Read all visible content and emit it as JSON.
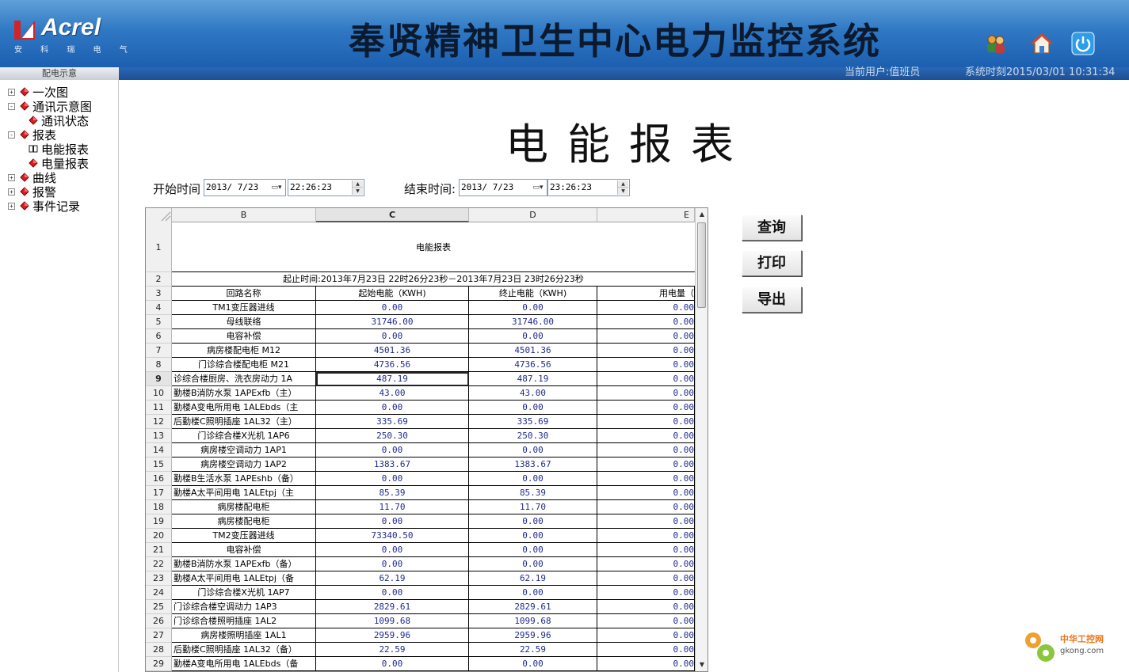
{
  "header": {
    "logo_text": "Acrel",
    "logo_sub": "安 科 瑞 电 气",
    "system_title": "奉贤精神卫生中心电力监控系统",
    "current_user": "当前用户:值班员",
    "system_time": "系统时刻2015/03/01 10:31:34",
    "icons": [
      "users-icon",
      "home-icon",
      "power-icon"
    ]
  },
  "sidebar": {
    "title": "配电示意",
    "items": [
      {
        "label": "一次图",
        "expander": "+"
      },
      {
        "label": "通讯示意图",
        "expander": "-"
      },
      {
        "label": "通讯状态",
        "expander": ""
      },
      {
        "label": "报表",
        "expander": "-"
      },
      {
        "label": "电能报表",
        "expander": ""
      },
      {
        "label": "电量报表",
        "expander": ""
      },
      {
        "label": "曲线",
        "expander": "+"
      },
      {
        "label": "报警",
        "expander": "+"
      },
      {
        "label": "事件记录",
        "expander": "+"
      }
    ]
  },
  "report": {
    "title": "电能报表",
    "start_label": "开始时间",
    "start_date": "2013/ 7/23",
    "start_time": "22:26:23",
    "end_label": "结束时间:",
    "end_date": "2013/ 7/23",
    "end_time": "23:26:23",
    "buttons": {
      "query": "查询",
      "print": "打印",
      "export": "导出"
    }
  },
  "grid": {
    "columns": [
      "B",
      "C",
      "D",
      "E"
    ],
    "selected_column": "C",
    "title_row": "电能报表",
    "period_row": "起止时间:2013年7月23日 22时26分23秒－2013年7月23日 23时26分23秒",
    "header_row": {
      "b": "回路名称",
      "c": "起始电能（KWH)",
      "d": "终止电能（KWH)",
      "e": "用电量（"
    },
    "selected_row": "9",
    "rows": [
      {
        "n": "4",
        "b": "TM1变压器进线",
        "c": "0.00",
        "d": "0.00",
        "e": "0.00"
      },
      {
        "n": "5",
        "b": "母线联络",
        "c": "31746.00",
        "d": "31746.00",
        "e": "0.00"
      },
      {
        "n": "6",
        "b": "电容补偿",
        "c": "0.00",
        "d": "0.00",
        "e": "0.00"
      },
      {
        "n": "7",
        "b": "病房楼配电柜 M12",
        "c": "4501.36",
        "d": "4501.36",
        "e": "0.00"
      },
      {
        "n": "8",
        "b": "门诊综合楼配电柜 M21",
        "c": "4736.56",
        "d": "4736.56",
        "e": "0.00"
      },
      {
        "n": "9",
        "b": "诊综合楼厨房、洗衣房动力 1A",
        "c": "487.19",
        "d": "487.19",
        "e": "0.00"
      },
      {
        "n": "10",
        "b": "勤楼B消防水泵 1APExfb（主）",
        "c": "43.00",
        "d": "43.00",
        "e": "0.00"
      },
      {
        "n": "11",
        "b": "勤楼A变电所用电 1ALEbds（主",
        "c": "0.00",
        "d": "0.00",
        "e": "0.00"
      },
      {
        "n": "12",
        "b": "后勤楼C照明插座 1AL32（主）",
        "c": "335.69",
        "d": "335.69",
        "e": "0.00"
      },
      {
        "n": "13",
        "b": "门诊综合楼X光机 1AP6",
        "c": "250.30",
        "d": "250.30",
        "e": "0.00"
      },
      {
        "n": "14",
        "b": "病房楼空调动力 1AP1",
        "c": "0.00",
        "d": "0.00",
        "e": "0.00"
      },
      {
        "n": "15",
        "b": "病房楼空调动力 1AP2",
        "c": "1383.67",
        "d": "1383.67",
        "e": "0.00"
      },
      {
        "n": "16",
        "b": "勤楼B生活水泵 1APEshb（备）",
        "c": "0.00",
        "d": "0.00",
        "e": "0.00"
      },
      {
        "n": "17",
        "b": "勤楼A太平间用电 1ALEtpj（主",
        "c": "85.39",
        "d": "85.39",
        "e": "0.00"
      },
      {
        "n": "18",
        "b": "病房楼配电柜",
        "c": "11.70",
        "d": "11.70",
        "e": "0.00"
      },
      {
        "n": "19",
        "b": "病房楼配电柜",
        "c": "0.00",
        "d": "0.00",
        "e": "0.00"
      },
      {
        "n": "20",
        "b": "TM2变压器进线",
        "c": "73340.50",
        "d": "0.00",
        "e": "0.00"
      },
      {
        "n": "21",
        "b": "电容补偿",
        "c": "0.00",
        "d": "0.00",
        "e": "0.00"
      },
      {
        "n": "22",
        "b": "勤楼B消防水泵 1APExfb（备）",
        "c": "0.00",
        "d": "0.00",
        "e": "0.00"
      },
      {
        "n": "23",
        "b": "勤楼A太平间用电 1ALEtpj（备",
        "c": "62.19",
        "d": "62.19",
        "e": "0.00"
      },
      {
        "n": "24",
        "b": "门诊综合楼X光机 1AP7",
        "c": "0.00",
        "d": "0.00",
        "e": "0.00"
      },
      {
        "n": "25",
        "b": "门诊综合楼空调动力 1AP3",
        "c": "2829.61",
        "d": "2829.61",
        "e": "0.00"
      },
      {
        "n": "26",
        "b": "门诊综合楼照明插座 1AL2",
        "c": "1099.68",
        "d": "1099.68",
        "e": "0.00"
      },
      {
        "n": "27",
        "b": "病房楼照明插座 1AL1",
        "c": "2959.96",
        "d": "2959.96",
        "e": "0.00"
      },
      {
        "n": "28",
        "b": "后勤楼C照明插座 1AL32（备）",
        "c": "22.59",
        "d": "22.59",
        "e": "0.00"
      },
      {
        "n": "29",
        "b": "勤楼A变电所用电 1ALEbds（备",
        "c": "0.00",
        "d": "0.00",
        "e": "0.00"
      }
    ]
  },
  "watermark": {
    "line1": "中华工控网",
    "line2": "gkong.com"
  },
  "colors": {
    "header_blue": "#2f78c4",
    "cell_value_blue": "#1f2a8c",
    "logo_red": "#d2232a"
  }
}
